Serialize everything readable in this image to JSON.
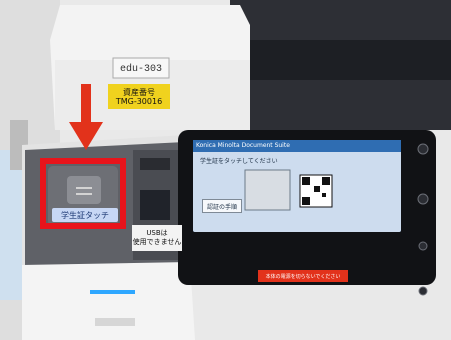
{
  "device": {
    "name_plate": "edu-303",
    "asset_label": {
      "line1": "資産番号",
      "line2": "TMG-30016"
    },
    "card_reader_label": "学生証タッチ",
    "usb_notice": {
      "line1": "USBは",
      "line2": "使用できません"
    },
    "screen": {
      "header": "Konica Minolta Document Suite",
      "subtext": "学生証をタッチしてください",
      "button_label": "認証の手順",
      "bottom_notice": "本体の電源を切らないでください"
    }
  },
  "colors": {
    "highlight_red": "#e8141b",
    "arrow_red": "#e2321b",
    "label_yellow": "#f0d21e",
    "screen_blue": "#2f6db2"
  }
}
